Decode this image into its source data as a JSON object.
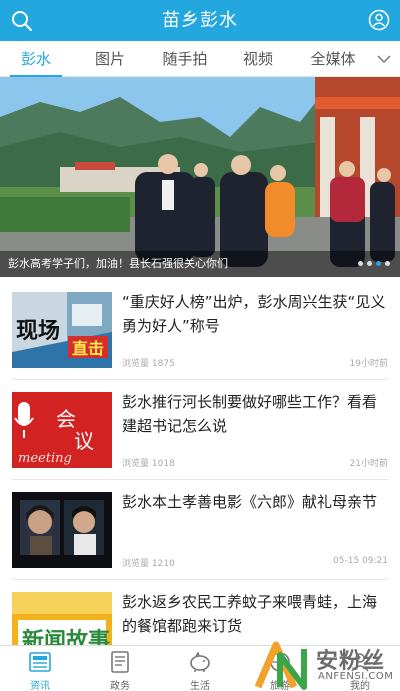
{
  "app": {
    "title": "苗乡彭水"
  },
  "icons": {
    "search": "search-icon",
    "user": "user-icon",
    "more": "chevron-down-icon"
  },
  "colors": {
    "accent": "#22a7df"
  },
  "tabs": [
    {
      "label": "彭水",
      "active": true
    },
    {
      "label": "图片"
    },
    {
      "label": "随手拍"
    },
    {
      "label": "视频"
    },
    {
      "label": "全媒体"
    }
  ],
  "banner": {
    "caption": "彭水高考学子们，加油！县长石强很关心你们",
    "dots": 4,
    "active_dot": 3
  },
  "news": [
    {
      "title": "“重庆好人榜”出炉，彭水周兴生获“见义勇为好人”称号",
      "views": "浏览量 1875",
      "time": "19小时前",
      "thumb_text": "现场直击"
    },
    {
      "title": "彭水推行河长制要做好哪些工作？看看建超书记怎么说",
      "views": "浏览量 1018",
      "time": "21小时前",
      "thumb_text": "会议 meeting"
    },
    {
      "title": "彭水本土孝善电影《六郎》献礼母亲节",
      "views": "浏览量 1210",
      "time": "05-15 09:21",
      "thumb_text": ""
    },
    {
      "title": "彭水返乡农民工养蚊子来喂青蛙，上海的餐馆都跑来订货",
      "views": "",
      "time": "",
      "thumb_text": "新闻故事"
    }
  ],
  "bottom_nav": [
    {
      "label": "资讯",
      "icon": "news-icon",
      "active": true
    },
    {
      "label": "政务",
      "icon": "document-icon"
    },
    {
      "label": "生活",
      "icon": "piggy-bank-icon"
    },
    {
      "label": "旅游",
      "icon": "travel-icon"
    },
    {
      "label": "我的",
      "icon": "profile-icon"
    }
  ],
  "watermark": {
    "text": "安粉丝",
    "sub": "ANFENSI.COM"
  }
}
